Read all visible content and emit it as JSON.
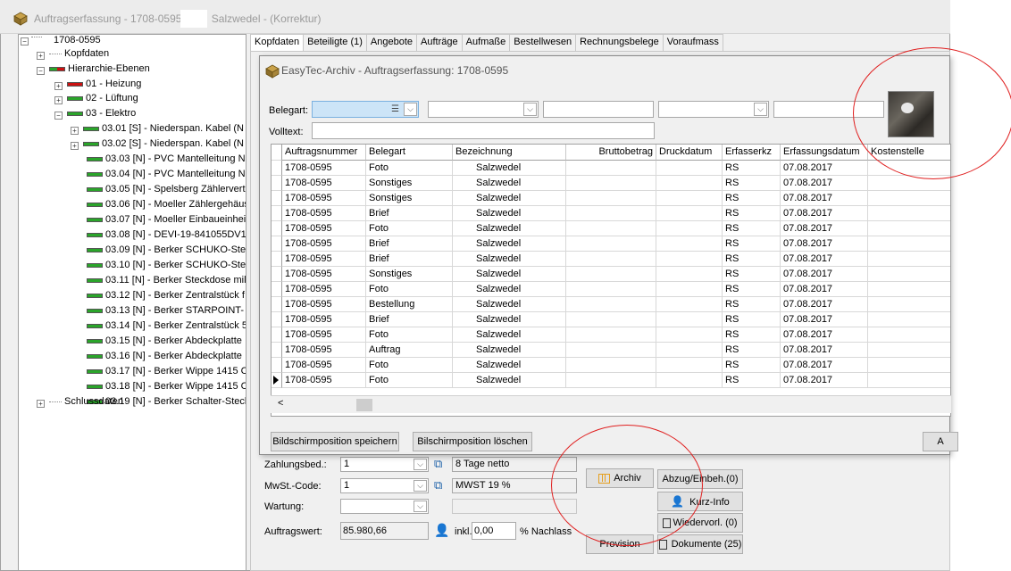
{
  "window": {
    "title": "Auftragserfassung - 1708-0595,",
    "title_rest": "Salzwedel - (Korrektur)"
  },
  "tree": {
    "root": "1708-0595",
    "kopfdaten": "Kopfdaten",
    "hierarchie": "Hierarchie-Ebenen",
    "heizung": "01 - Heizung",
    "lueftung": "02 - Lüftung",
    "elektro": "03 - Elektro",
    "items": [
      "03.01 [S] - Niederspan. Kabel (N",
      "03.02 [S] - Niederspan. Kabel (N",
      "03.03 [N] - PVC Mantelleitung N'",
      "03.04 [N] - PVC Mantelleitung N'",
      "03.05 [N] - Spelsberg Zählerverte",
      "03.06 [N] - Moeller Zählergehäus",
      "03.07 [N] - Moeller Einbaueinheil",
      "03.08 [N] - DEVI-19-841055DV1",
      "03.09 [N] - Berker SCHUKO-Stec",
      "03.10 [N] - Berker SCHUKO-Stec",
      "03.11 [N] - Berker Steckdose mil",
      "03.12 [N] - Berker Zentralstück f",
      "03.13 [N] - Berker STARPOINT-",
      "03.14 [N] - Berker Zentralstück 5",
      "03.15 [N] - Berker Abdeckplatte",
      "03.16 [N] - Berker Abdeckplatte",
      "03.17 [N] - Berker Wippe 1415 C",
      "03.18 [N] - Berker Wippe 1415 C",
      "03.19 [N] - Berker Schalter-Stecl"
    ],
    "schlussdaten": "Schlussdaten"
  },
  "tabs": [
    "Kopfdaten",
    "Beteiligte (1)",
    "Angebote",
    "Aufträge",
    "Aufmaße",
    "Bestellwesen",
    "Rechnungsbelege",
    "Voraufmass"
  ],
  "dialog": {
    "title": "EasyTec-Archiv - Auftragserfassung: 1708-0595",
    "belegart_label": "Belegart:",
    "volltext_label": "Volltext:",
    "columns": [
      "Auftragsnummer",
      "Belegart",
      "Bezeichnung",
      "Bruttobetrag",
      "Druckdatum",
      "Erfasserkz",
      "Erfassungsdatum",
      "Kostenstelle"
    ],
    "rows": [
      {
        "nr": "1708-0595",
        "art": "Foto",
        "bez": "Salzwedel",
        "kz": "RS",
        "datum": "07.08.2017"
      },
      {
        "nr": "1708-0595",
        "art": "Sonstiges",
        "bez": "Salzwedel",
        "kz": "RS",
        "datum": "07.08.2017"
      },
      {
        "nr": "1708-0595",
        "art": "Sonstiges",
        "bez": "Salzwedel",
        "kz": "RS",
        "datum": "07.08.2017"
      },
      {
        "nr": "1708-0595",
        "art": "Brief",
        "bez": "Salzwedel",
        "kz": "RS",
        "datum": "07.08.2017"
      },
      {
        "nr": "1708-0595",
        "art": "Foto",
        "bez": "Salzwedel",
        "kz": "RS",
        "datum": "07.08.2017"
      },
      {
        "nr": "1708-0595",
        "art": "Brief",
        "bez": "Salzwedel",
        "kz": "RS",
        "datum": "07.08.2017"
      },
      {
        "nr": "1708-0595",
        "art": "Brief",
        "bez": "Salzwedel",
        "kz": "RS",
        "datum": "07.08.2017"
      },
      {
        "nr": "1708-0595",
        "art": "Sonstiges",
        "bez": "Salzwedel",
        "kz": "RS",
        "datum": "07.08.2017"
      },
      {
        "nr": "1708-0595",
        "art": "Foto",
        "bez": "Salzwedel",
        "kz": "RS",
        "datum": "07.08.2017"
      },
      {
        "nr": "1708-0595",
        "art": "Bestellung",
        "bez": "Salzwedel",
        "kz": "RS",
        "datum": "07.08.2017"
      },
      {
        "nr": "1708-0595",
        "art": "Brief",
        "bez": "Salzwedel",
        "kz": "RS",
        "datum": "07.08.2017"
      },
      {
        "nr": "1708-0595",
        "art": "Foto",
        "bez": "Salzwedel",
        "kz": "RS",
        "datum": "07.08.2017"
      },
      {
        "nr": "1708-0595",
        "art": "Auftrag",
        "bez": "Salzwedel",
        "kz": "RS",
        "datum": "07.08.2017"
      },
      {
        "nr": "1708-0595",
        "art": "Foto",
        "bez": "Salzwedel",
        "kz": "RS",
        "datum": "07.08.2017"
      },
      {
        "nr": "1708-0595",
        "art": "Foto",
        "bez": "Salzwedel",
        "kz": "RS",
        "datum": "07.08.2017"
      }
    ],
    "scroll_left": "<",
    "save_pos": "Bildschirmposition speichern",
    "delete_pos": "Bilschirmposition löschen",
    "right_btn": "A"
  },
  "kopf": {
    "zahlungsbed_label": "Zahlungsbed.:",
    "zahlungsbed_value": "1",
    "zahlungsbed_text": "8 Tage netto",
    "mwst_label": "MwSt.-Code:",
    "mwst_value": "1",
    "mwst_text": "MWST 19 %",
    "wartung_label": "Wartung:",
    "auftragswert_label": "Auftragswert:",
    "auftragswert_value": "85.980,66",
    "inkl_label": "inkl.",
    "nachlass_value": "0,00",
    "nachlass_label": "% Nachlass",
    "archiv": "Archiv",
    "abzug": "Abzug/Einbeh.(0)",
    "kurzinfo": "Kurz-Info",
    "wiedervorl": "Wiedervorl. (0)",
    "provision": "Provision",
    "dokumente": "Dokumente (25)"
  },
  "colors": {
    "highlight": "#cce4f7",
    "annotation": "#e02020"
  }
}
